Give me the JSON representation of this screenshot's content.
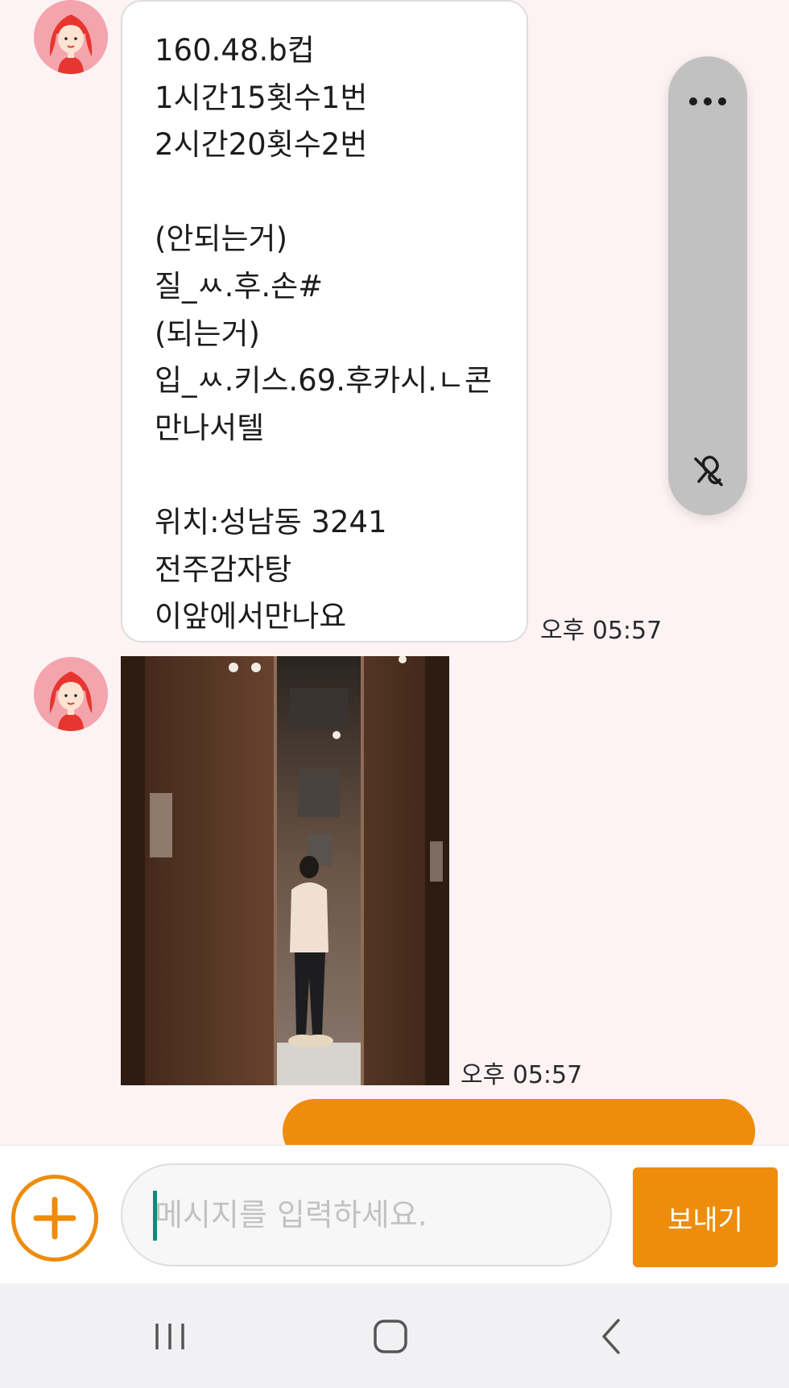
{
  "messages": [
    {
      "type": "text",
      "sender": "received",
      "lines": [
        "160.48.b컵",
        "1시간15횟수1번",
        "2시간20횟수2번",
        "",
        "(안되는거)",
        "질_ㅆ.후.손#",
        "(되는거)",
        "입_ㅆ.키스.69.후카시.ㄴ콘",
        "만나서텔",
        "",
        "위치:성남동 3241",
        "전주감자탕",
        "이앞에서만나요"
      ],
      "time": "오후 05:57"
    },
    {
      "type": "image",
      "sender": "received",
      "time": "오후 05:57"
    }
  ],
  "floating_panel": {
    "more_icon": "more-dots-icon",
    "unpin_icon": "unpin-icon"
  },
  "input_bar": {
    "placeholder": "메시지를 입력하세요.",
    "value": "",
    "send_label": "보내기",
    "attach_icon": "plus-circle-icon"
  },
  "navigation": {
    "recent_icon": "recent-apps-icon",
    "home_icon": "home-icon",
    "back_icon": "back-icon"
  },
  "colors": {
    "accent": "#ee8c0c",
    "background": "#fdf3f4",
    "bubble": "#ffffff",
    "avatar": "#f4a4ad"
  }
}
